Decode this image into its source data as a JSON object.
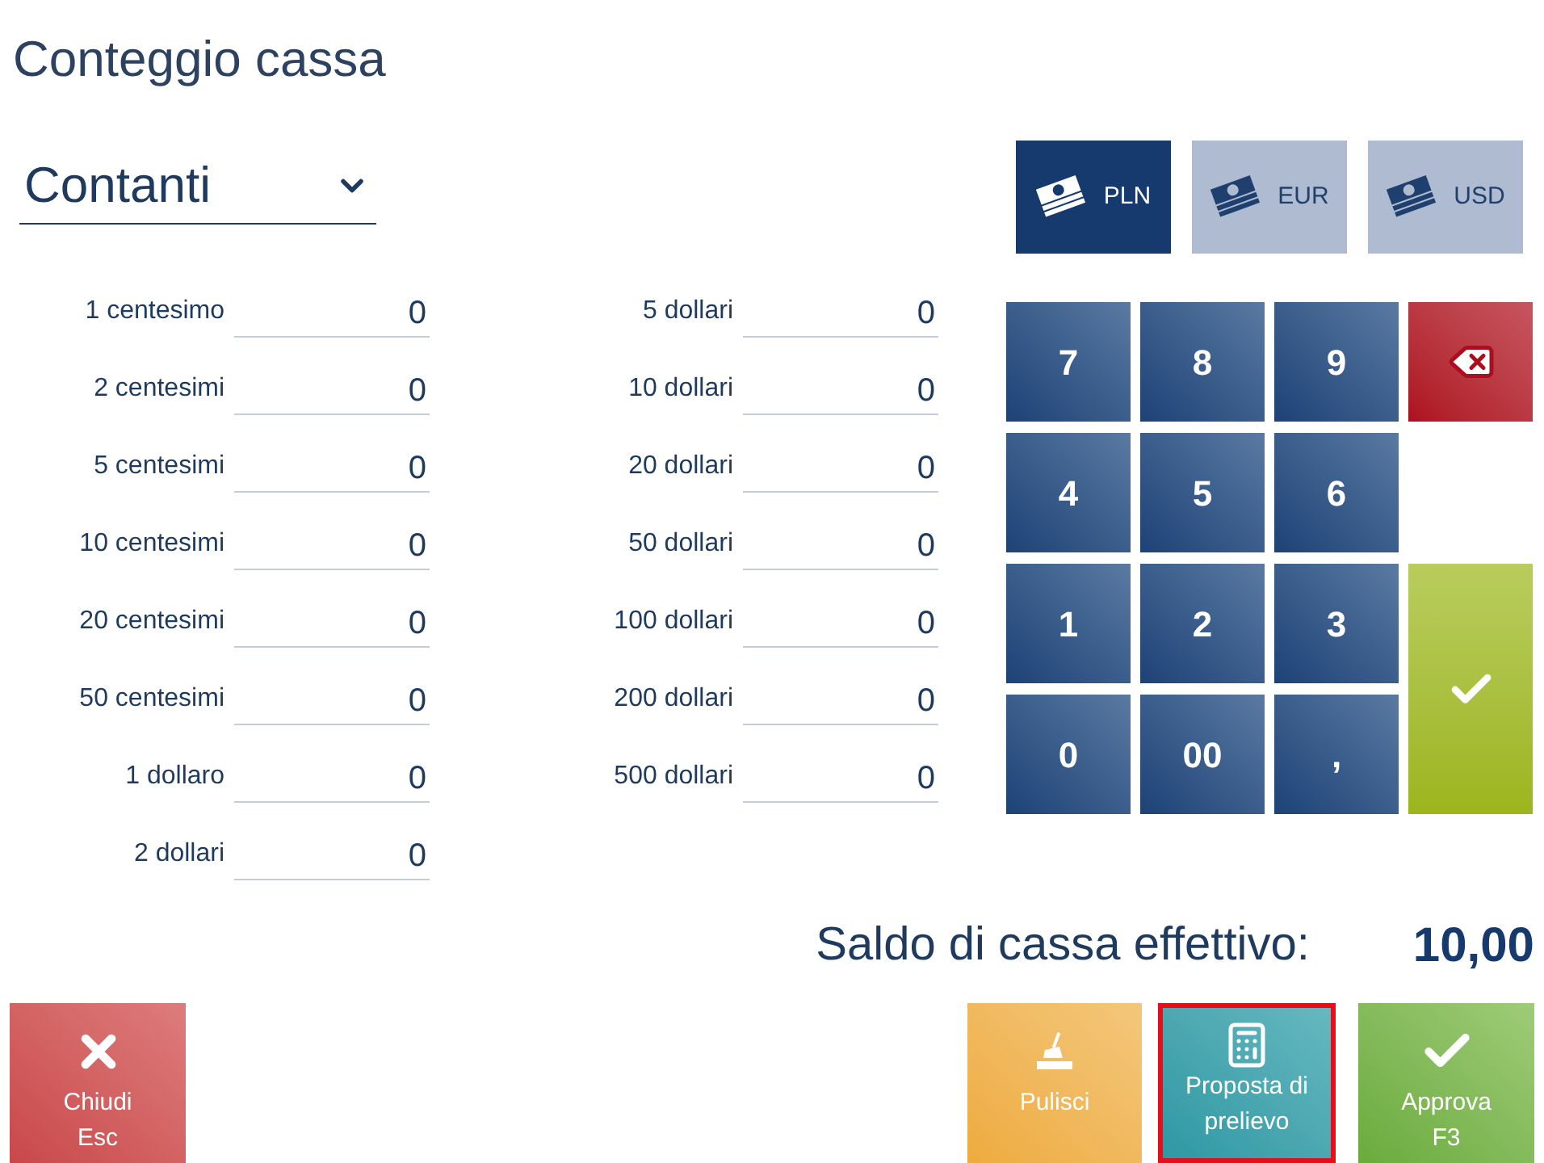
{
  "title": "Conteggio cassa",
  "payment_type": {
    "value": "Contanti"
  },
  "currencies": [
    {
      "label": "PLN",
      "selected": true
    },
    {
      "label": "EUR",
      "selected": false
    },
    {
      "label": "USD",
      "selected": false
    }
  ],
  "denominations_left": [
    {
      "label": "1 centesimo",
      "value": "0"
    },
    {
      "label": "2 centesimi",
      "value": "0"
    },
    {
      "label": "5 centesimi",
      "value": "0"
    },
    {
      "label": "10 centesimi",
      "value": "0"
    },
    {
      "label": "20 centesimi",
      "value": "0"
    },
    {
      "label": "50 centesimi",
      "value": "0"
    },
    {
      "label": "1 dollaro",
      "value": "0"
    },
    {
      "label": "2 dollari",
      "value": "0"
    }
  ],
  "denominations_right": [
    {
      "label": "5 dollari",
      "value": "0"
    },
    {
      "label": "10 dollari",
      "value": "0"
    },
    {
      "label": "20 dollari",
      "value": "0"
    },
    {
      "label": "50 dollari",
      "value": "0"
    },
    {
      "label": "100 dollari",
      "value": "0"
    },
    {
      "label": "200 dollari",
      "value": "0"
    },
    {
      "label": "500 dollari",
      "value": "0"
    }
  ],
  "keypad": {
    "digits": [
      "7",
      "8",
      "9",
      "4",
      "5",
      "6",
      "1",
      "2",
      "3",
      "0",
      "00",
      ","
    ]
  },
  "balance": {
    "label": "Saldo di cassa effettivo:",
    "value": "10,00"
  },
  "buttons": [
    {
      "kind": "close",
      "label": "Chiudi",
      "shortcut": "Esc",
      "highlighted": false
    },
    {
      "kind": "clear",
      "label": "Pulisci",
      "highlighted": false
    },
    {
      "kind": "proposal",
      "label": "Proposta di prelievo",
      "highlighted": true
    },
    {
      "kind": "approve",
      "label": "Approva",
      "shortcut": "F3",
      "highlighted": false
    }
  ]
}
